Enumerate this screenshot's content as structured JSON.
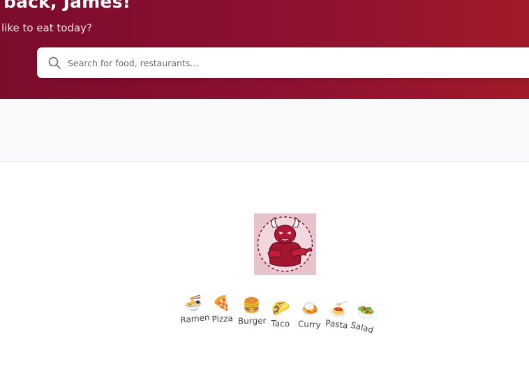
{
  "hero": {
    "title": "back, James!",
    "subtitle": "like to eat today?"
  },
  "search": {
    "placeholder": "Search for food, restaurants...",
    "value": "",
    "icon": "search-icon"
  },
  "colors": {
    "brand": "#870e2e",
    "brand_end": "#a11a2a"
  },
  "logo": {
    "icon": "red-bull-mascot-logo"
  },
  "categories": [
    {
      "label": "Ramen",
      "icon": "ramen-bowl-icon",
      "glyph": "🍜"
    },
    {
      "label": "Pizza",
      "icon": "pizza-icon",
      "glyph": "🍕"
    },
    {
      "label": "Burger",
      "icon": "burger-icon",
      "glyph": "🍔"
    },
    {
      "label": "Taco",
      "icon": "taco-icon",
      "glyph": "🌮"
    },
    {
      "label": "Curry",
      "icon": "curry-icon",
      "glyph": "🍛"
    },
    {
      "label": "Pasta",
      "icon": "pasta-icon",
      "glyph": "🍝"
    },
    {
      "label": "Salad",
      "icon": "salad-icon",
      "glyph": "🥗"
    },
    {
      "label": "",
      "icon": "more-category-icon",
      "glyph": ""
    }
  ]
}
